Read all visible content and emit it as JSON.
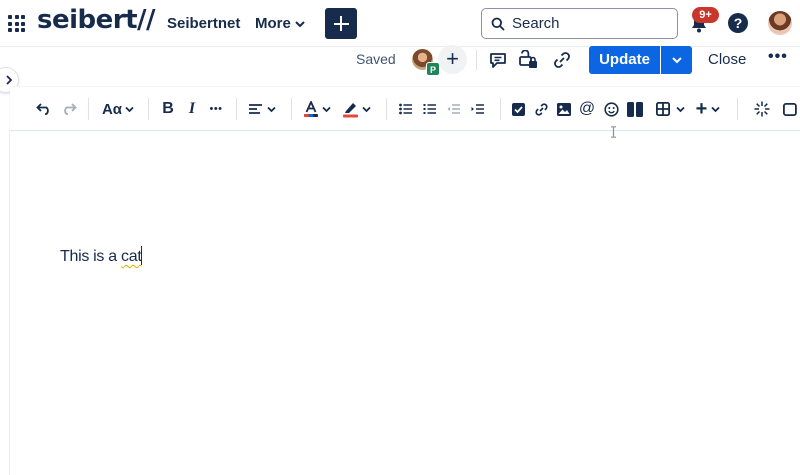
{
  "topnav": {
    "logo_text": "seibert//",
    "space_link": "Seibertnet",
    "more_label": "More",
    "search_placeholder": "Search",
    "notifications_badge": "9+",
    "help_label": "?"
  },
  "editor_header": {
    "status": "Saved",
    "collaborator_initial": "P",
    "invite_label": "+",
    "update_label": "Update",
    "close_label": "Close",
    "more_actions_label": "•••"
  },
  "toolbar": {
    "text_style_label": "Aα",
    "bold_label": "B",
    "italic_label": "I",
    "more_formatting_label": "•••",
    "mention_label": "@",
    "insert_label": "+"
  },
  "content": {
    "text_plain": "This is a ",
    "text_flagged": "cat"
  },
  "colors": {
    "primary": "#0c66e4",
    "text": "#172b4d",
    "notification": "#c9372c",
    "collaborator_badge": "#1f845a"
  }
}
